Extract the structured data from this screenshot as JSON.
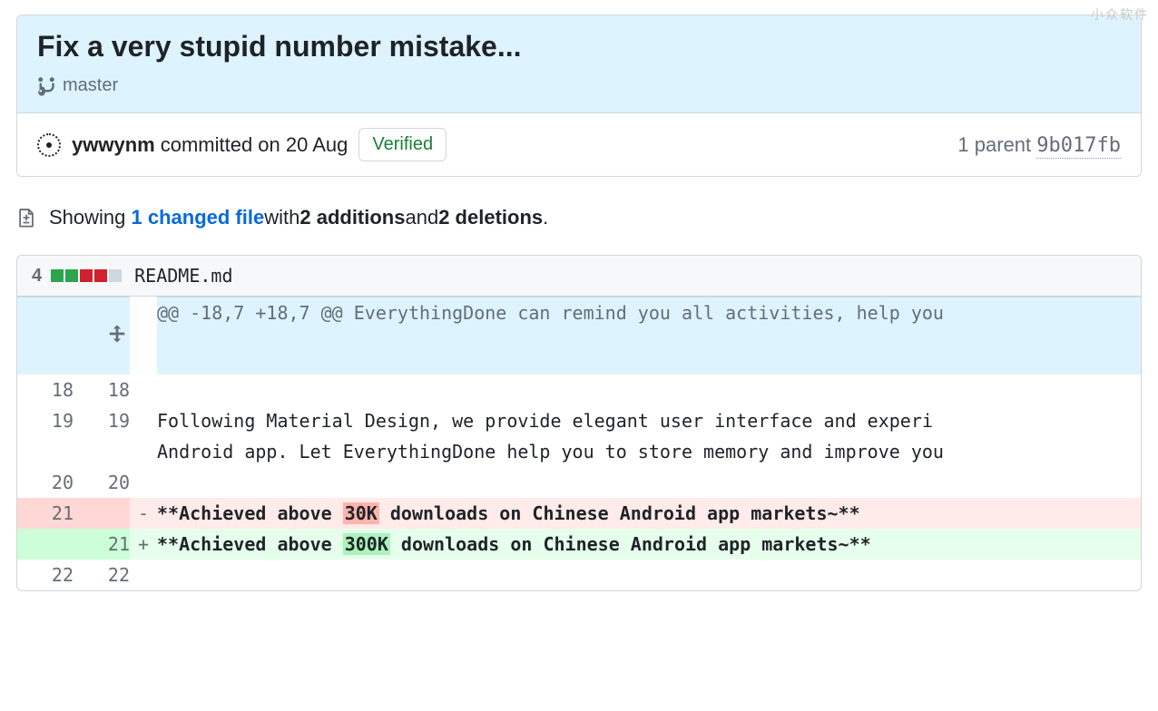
{
  "watermark": "小众软件",
  "commit": {
    "title": "Fix a very stupid number mistake...",
    "branch": "master",
    "author": "ywwynm",
    "committed_text": "committed on 20 Aug",
    "verified_label": "Verified",
    "parent_text": "1 parent",
    "parent_sha": "9b017fb"
  },
  "diffstat": {
    "showing": "Showing",
    "changed_files": "1 changed file",
    "with": " with ",
    "additions": "2 additions",
    "and": " and ",
    "deletions": "2 deletions",
    "period": "."
  },
  "file": {
    "changes_count": "4",
    "name": "README.md",
    "hunk_header": "@@ -18,7 +18,7 @@ EverythingDone can remind you all activities, help you",
    "rows": [
      {
        "type": "ctx",
        "a": "18",
        "b": "18",
        "text": ""
      },
      {
        "type": "ctx",
        "a": "19",
        "b": "19",
        "text": "Following Material Design, we provide elegant user interface and experi"
      },
      {
        "type": "wrap",
        "text": "Android app. Let EverythingDone help you to store memory and improve you"
      },
      {
        "type": "ctx",
        "a": "20",
        "b": "20",
        "text": ""
      },
      {
        "type": "del",
        "a": "21",
        "b": "",
        "pre": "**Achieved above ",
        "mark": "30K",
        "post": " downloads on Chinese Android app markets~**"
      },
      {
        "type": "add",
        "a": "",
        "b": "21",
        "pre": "**Achieved above ",
        "mark": "300K",
        "post": " downloads on Chinese Android app markets~**"
      },
      {
        "type": "ctx",
        "a": "22",
        "b": "22",
        "text": ""
      }
    ]
  }
}
